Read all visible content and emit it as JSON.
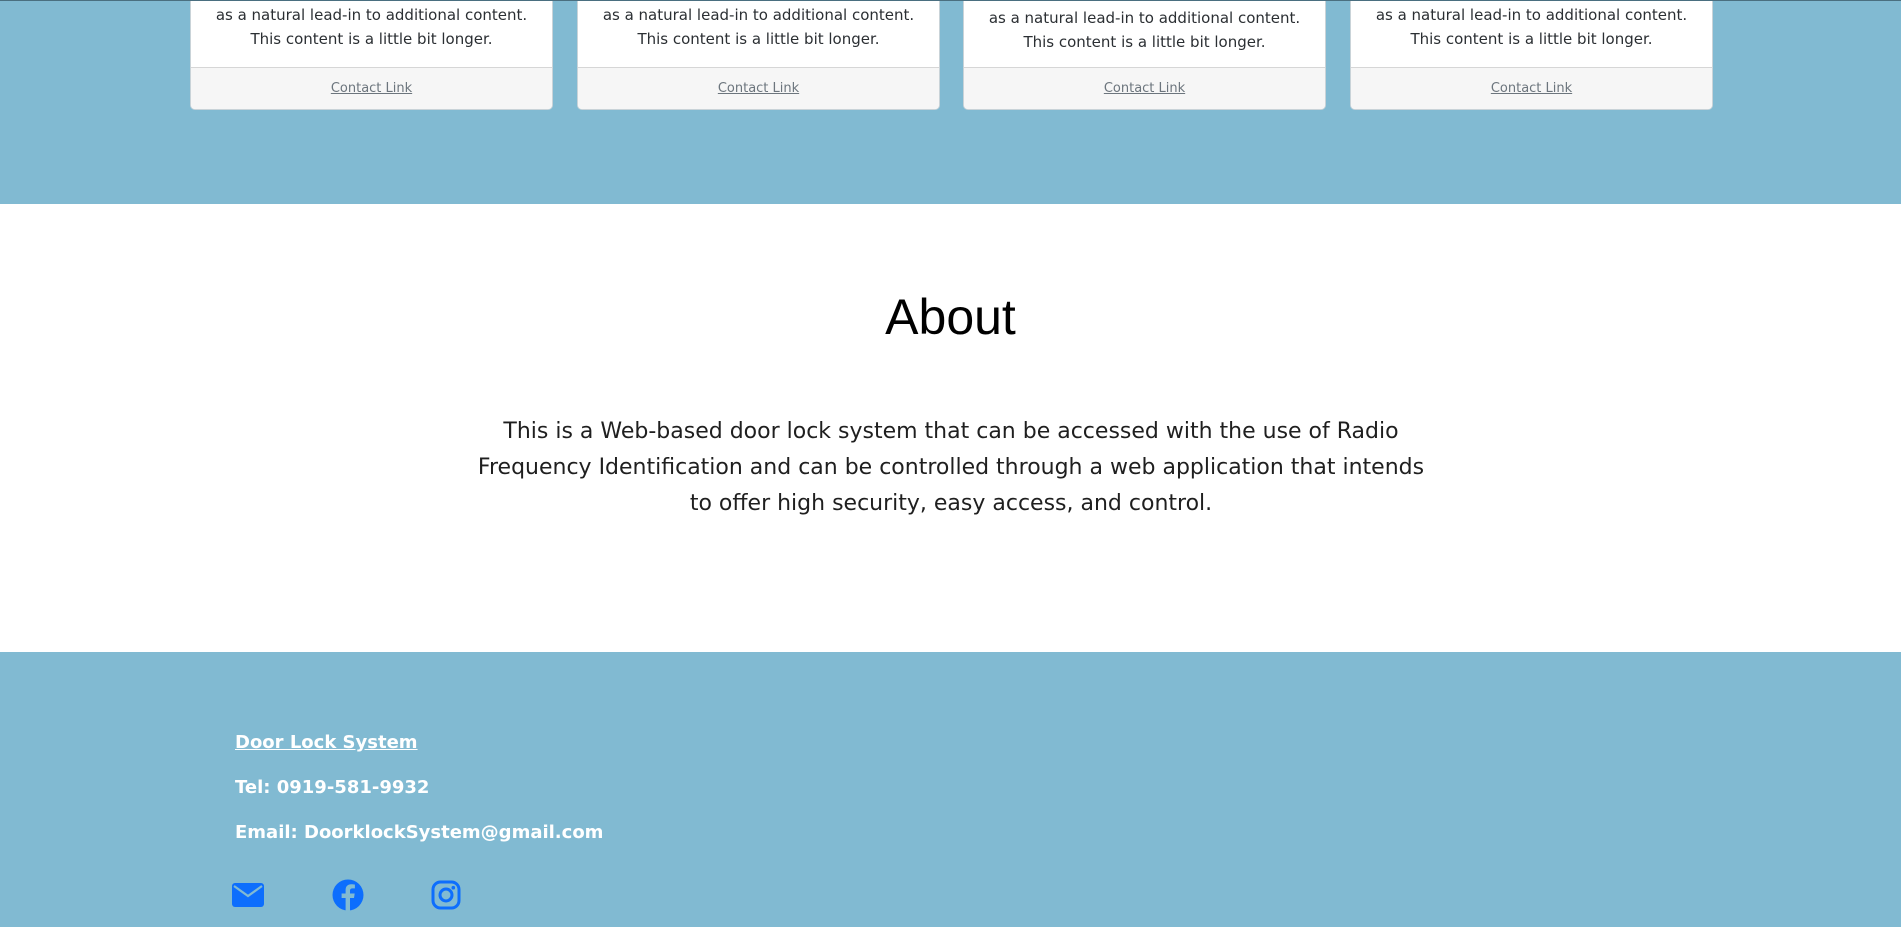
{
  "cards": [
    {
      "text": "as a natural lead-in to additional content. This content is a little bit longer.",
      "link": "Contact Link"
    },
    {
      "text": "as a natural lead-in to additional content. This content is a little bit longer.",
      "link": "Contact Link"
    },
    {
      "text": "as a natural lead-in to additional content. This content is a little bit longer.",
      "link": "Contact Link"
    },
    {
      "text": "as a natural lead-in to additional content. This content is a little bit longer.",
      "link": "Contact Link"
    }
  ],
  "about": {
    "title": "About",
    "text": "This is a Web-based door lock system that can be accessed with the use of Radio Frequency Identification and can be controlled through a web application that intends to offer high security, easy access, and control."
  },
  "footer": {
    "brand": "Door Lock System",
    "tel": "Tel: 0919-581-9932",
    "email": "Email: DoorklockSystem@gmail.com",
    "social_icons": [
      "envelope-icon",
      "facebook-icon",
      "instagram-icon"
    ]
  },
  "colors": {
    "band": "#81bad2",
    "icon": "#0d6efd",
    "footer_text": "#ffffff"
  }
}
